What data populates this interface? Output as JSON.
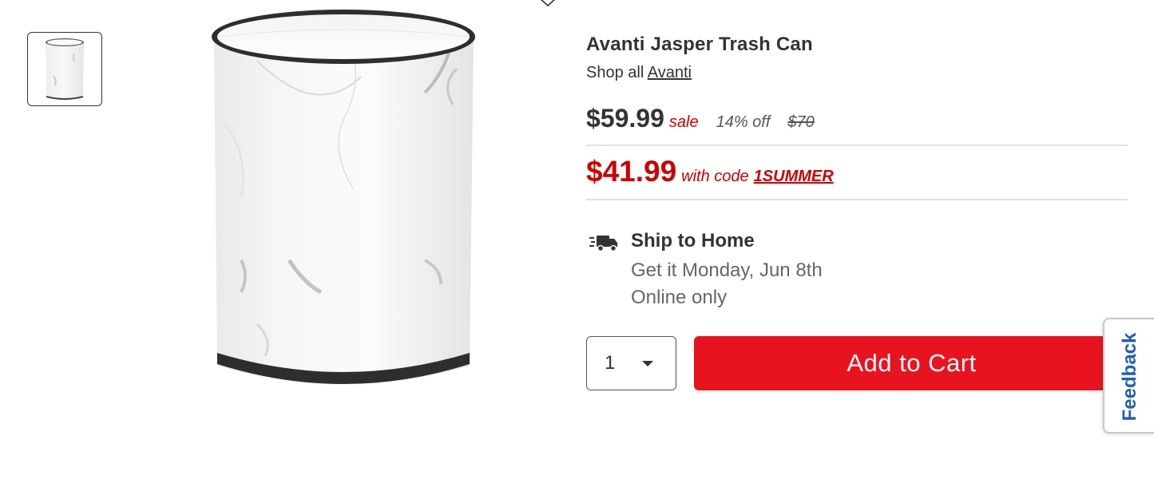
{
  "product": {
    "title": "Avanti Jasper Trash Can",
    "shop_all_prefix": "Shop all",
    "brand": "Avanti"
  },
  "pricing": {
    "price": "$59.99",
    "sale_label": "sale",
    "percent_off": "14% off",
    "regular_price": "$70",
    "promo_price": "$41.99",
    "promo_text": "with code",
    "promo_code": "1SUMMER"
  },
  "shipping": {
    "icon": "delivery-truck-icon",
    "title": "Ship to Home",
    "date_text": "Get it Monday, Jun 8th",
    "availability": "Online only"
  },
  "cart": {
    "quantity": "1",
    "add_label": "Add to Cart"
  },
  "feedback": {
    "label": "Feedback"
  },
  "colors": {
    "accent_red": "#e8131e",
    "promo_red": "#cc0000",
    "feedback_blue": "#1f5fb3"
  }
}
